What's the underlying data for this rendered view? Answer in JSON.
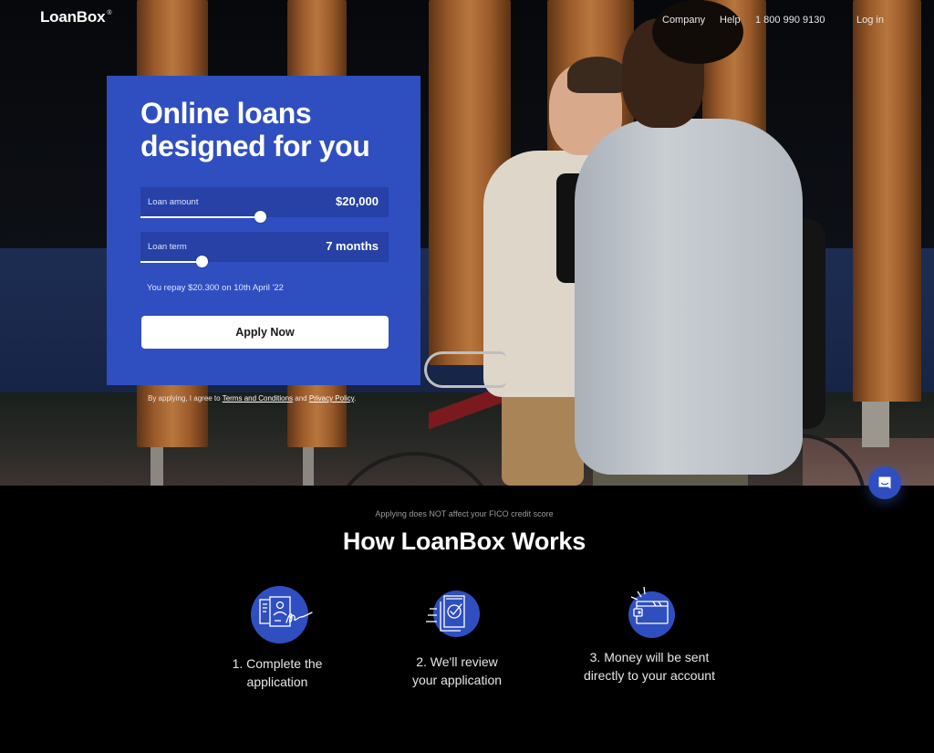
{
  "header": {
    "logo": "LoanBox",
    "logo_mark": "®",
    "nav": {
      "company": "Company",
      "help": "Help",
      "phone": "1 800 990 9130",
      "login": "Log in"
    }
  },
  "hero": {
    "title": "Online loans designed for you",
    "loan_amount": {
      "label": "Loan amount",
      "value": "$20,000",
      "slider_fraction": 0.48
    },
    "loan_term": {
      "label": "Loan term",
      "value": "7 months",
      "slider_fraction": 0.245
    },
    "repay_text": "You repay $20.300 on 10th April '22",
    "apply_label": "Apply Now",
    "terms": {
      "prefix": "By applying, I agree to ",
      "terms_link": "Terms and Conditions",
      "middle": " and ",
      "privacy_link": "Privacy Policy",
      "suffix": "."
    }
  },
  "how_it_works": {
    "notice": "Applying does NOT affect your FICO credit score",
    "title": "How LoanBox Works",
    "steps": [
      {
        "icon": "application-form-icon",
        "line1": "1. Complete the",
        "line2": "application"
      },
      {
        "icon": "document-review-icon",
        "line1": "2. We'll review",
        "line2": "your application"
      },
      {
        "icon": "wallet-icon",
        "line1": "3. Money will be sent",
        "line2": "directly to your account"
      }
    ]
  },
  "chat": {
    "icon": "chat-icon"
  },
  "colors": {
    "brand_blue": "#2f4fc0",
    "field_blue": "#2741a6",
    "page_bg": "#000000"
  }
}
